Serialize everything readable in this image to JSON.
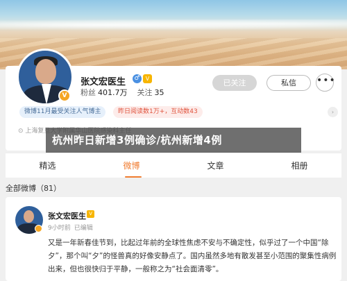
{
  "profile": {
    "name": "张文宏医生",
    "gender_icon": "male-icon",
    "vip_icon": "vip-icon",
    "fans_label": "粉丝",
    "fans_value": "401.7万",
    "following_label": "关注",
    "following_value": "35",
    "followed_button": "已关注",
    "message_button": "私信",
    "more_button": "•••",
    "tag_hot": "微博11月最受关注人气博主",
    "tag_reads": "昨日阅读数1万+，互动数43",
    "location_line": "上海复旦大学附属华山医院感染科主任"
  },
  "headline": "杭州昨日新增3例确诊/杭州新增4例",
  "tabs": [
    {
      "label": "精选"
    },
    {
      "label": "微博"
    },
    {
      "label": "文章"
    },
    {
      "label": "相册"
    }
  ],
  "active_tab": "微博",
  "section": {
    "title": "全部微博（81）"
  },
  "post": {
    "author": "张文宏医生",
    "time": "9小时前",
    "edited": "已编辑",
    "text": "又是一年新春佳节到，比起过年前的全球性焦虑不安与不确定性，似乎过了一个中国“除夕”，那个叫“夕”的怪兽真的好像安静点了。国内虽然多地有散发甚至小范围的聚集性病例出来，但也很快归于平静，一般称之为“社会面清零”。"
  },
  "colors": {
    "accent": "#f07c30",
    "followed_bg": "#d6d6d6",
    "tag_hot_bg": "#e6f0fb",
    "tag_reads_text": "#e0533d"
  }
}
